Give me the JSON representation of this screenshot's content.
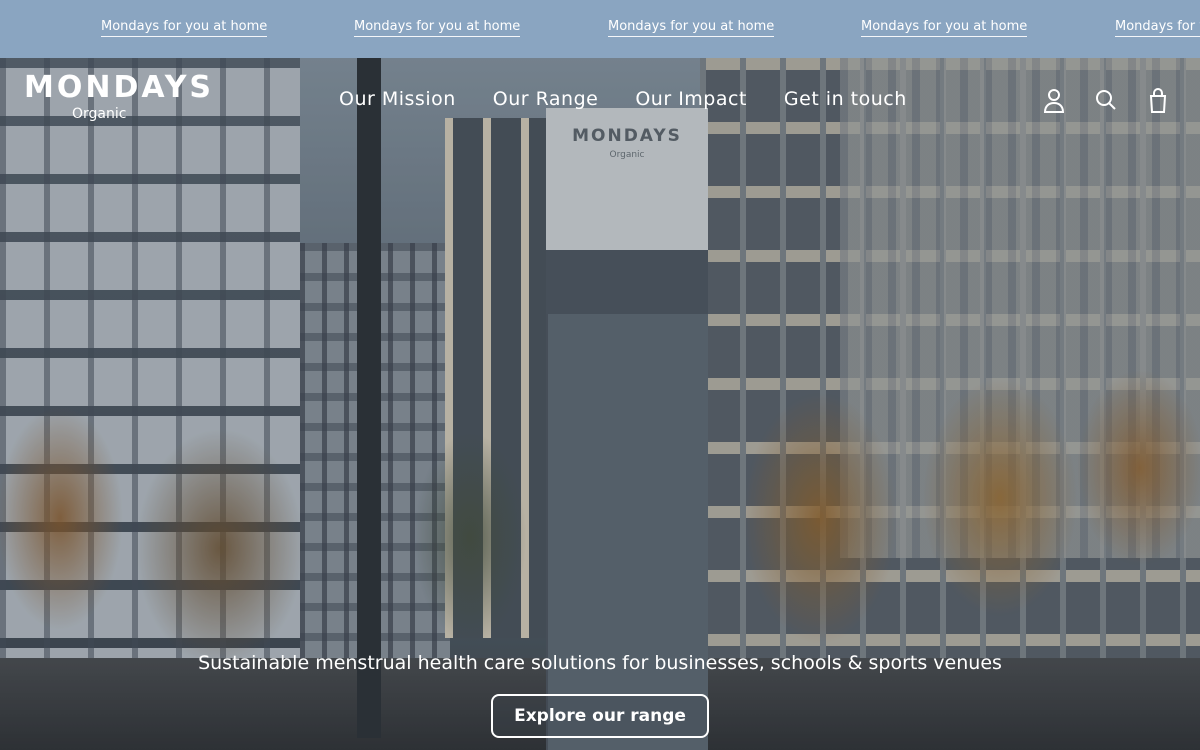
{
  "announcement": {
    "items": [
      "Mondays for you at home",
      "Mondays for you at home",
      "Mondays for you at home",
      "Mondays for you at home",
      "Mondays for you at home"
    ],
    "background": "#8aa5c1"
  },
  "header": {
    "logo": {
      "main": "MONDAYS",
      "sub": "Organic"
    },
    "nav": [
      "Our Mission",
      "Our Range",
      "Our Impact",
      "Get in touch"
    ],
    "icons": [
      "account-icon",
      "search-icon",
      "bag-icon"
    ]
  },
  "hero": {
    "kiosk_brand": "MONDAYS",
    "kiosk_sub": "Organic",
    "tagline": "Sustainable menstrual health care solutions for businesses, schools & sports venues",
    "cta_label": "Explore our range"
  }
}
